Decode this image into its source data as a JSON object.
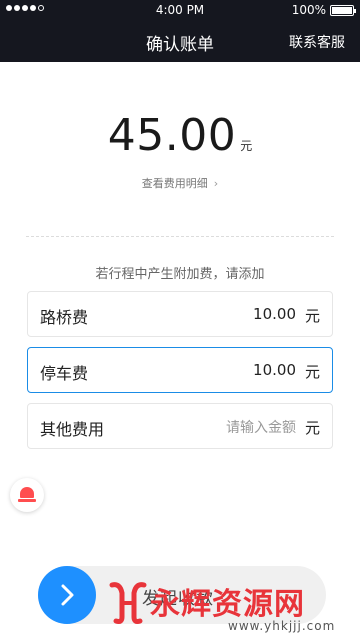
{
  "status_bar": {
    "time": "4:00 PM",
    "battery": "100%"
  },
  "header": {
    "title": "确认账单",
    "contact_label": "联系客服"
  },
  "bill": {
    "amount": "45.00",
    "unit": "元",
    "detail_link": "查看费用明细"
  },
  "extra_fees": {
    "hint": "若行程中产生附加费，请添加",
    "items": [
      {
        "label": "路桥费",
        "value": "10.00",
        "unit": "元"
      },
      {
        "label": "停车费",
        "value": "10.00",
        "unit": "元"
      },
      {
        "label": "其他费用",
        "placeholder": "请输入金额",
        "unit": "元"
      }
    ]
  },
  "slider": {
    "label": "发起收款"
  },
  "watermark": {
    "text": "永辉资源网",
    "url": "www.yhkjjj.com"
  },
  "colors": {
    "header_bg": "#15171f",
    "accent": "#1e90ff",
    "alarm": "#ff4d4f",
    "watermark": "#e8343a"
  }
}
